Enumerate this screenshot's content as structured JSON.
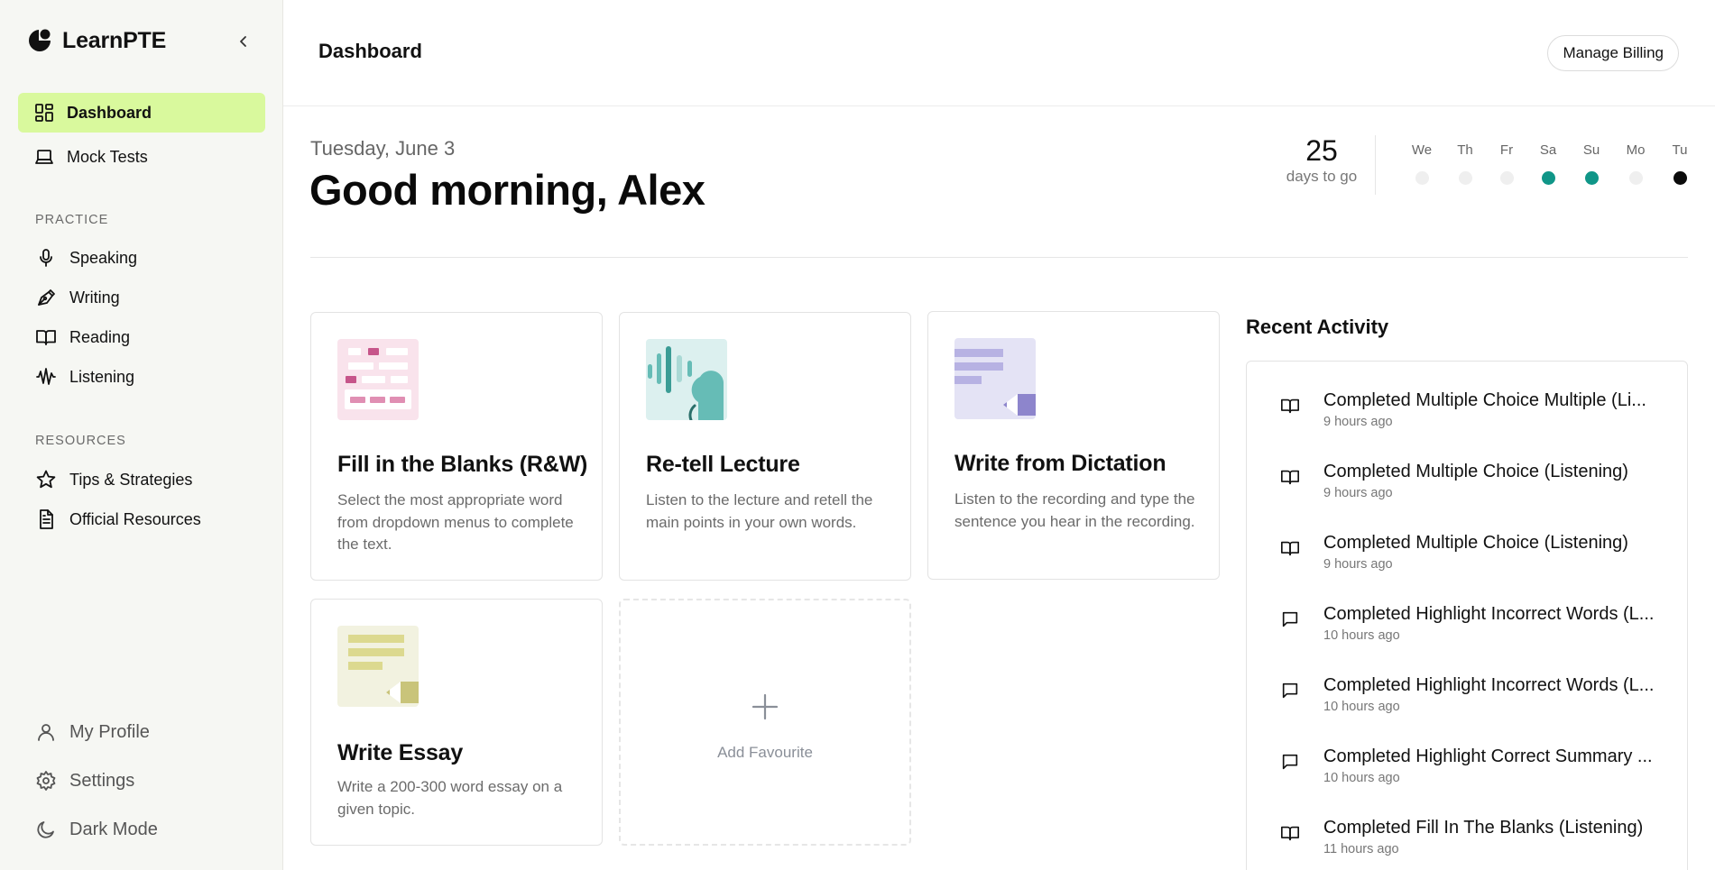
{
  "app": {
    "name": "LearnPTE"
  },
  "sidebar": {
    "main_items": [
      {
        "label": "Dashboard",
        "icon": "dashboard-icon",
        "active": true
      },
      {
        "label": "Mock Tests",
        "icon": "laptop-icon",
        "active": false
      }
    ],
    "practice": {
      "label": "PRACTICE",
      "items": [
        {
          "label": "Speaking",
          "icon": "microphone-icon"
        },
        {
          "label": "Writing",
          "icon": "pen-icon"
        },
        {
          "label": "Reading",
          "icon": "book-icon"
        },
        {
          "label": "Listening",
          "icon": "audio-wave-icon"
        }
      ]
    },
    "resources": {
      "label": "RESOURCES",
      "items": [
        {
          "label": "Tips & Strategies",
          "icon": "star-icon"
        },
        {
          "label": "Official Resources",
          "icon": "document-icon"
        }
      ]
    },
    "bottom_items": [
      {
        "label": "My Profile",
        "icon": "user-icon"
      },
      {
        "label": "Settings",
        "icon": "gear-icon"
      },
      {
        "label": "Dark Mode",
        "icon": "moon-icon"
      }
    ]
  },
  "header": {
    "title": "Dashboard",
    "billing_label": "Manage Billing"
  },
  "greeting": {
    "date": "Tuesday, June 3",
    "text": "Good morning, Alex",
    "countdown_value": "25",
    "countdown_label": "days to go"
  },
  "streak": [
    {
      "day": "We",
      "status": "none"
    },
    {
      "day": "Th",
      "status": "none"
    },
    {
      "day": "Fr",
      "status": "none"
    },
    {
      "day": "Sa",
      "status": "done"
    },
    {
      "day": "Su",
      "status": "done"
    },
    {
      "day": "Mo",
      "status": "none"
    },
    {
      "day": "Tu",
      "status": "today"
    }
  ],
  "favourites": [
    {
      "title": "Fill in the Blanks (R&W)",
      "description": "Select the most appropriate word from dropdown menus to complete the text.",
      "thumb_color": "#f9e3ec"
    },
    {
      "title": "Re-tell Lecture",
      "description": "Listen to the lecture and retell the main points in your own words.",
      "thumb_color": "#dcf0ef"
    },
    {
      "title": "Write from Dictation",
      "description": "Listen to the recording and type the sentence you hear in the recording.",
      "thumb_color": "#e4e3f5"
    },
    {
      "title": "Write Essay",
      "description": "Write a 200-300 word essay on a given topic.",
      "thumb_color": "#f2f2e0"
    }
  ],
  "add_favourite": {
    "label": "Add Favourite"
  },
  "recent_activity": {
    "title": "Recent Activity",
    "items": [
      {
        "prefix": "Completed",
        "name": "Multiple Choice Multiple (Li...",
        "time": "9 hours ago",
        "icon": "book-icon"
      },
      {
        "prefix": "Completed",
        "name": "Multiple Choice (Listening)",
        "time": "9 hours ago",
        "icon": "book-icon"
      },
      {
        "prefix": "Completed",
        "name": "Multiple Choice (Listening)",
        "time": "9 hours ago",
        "icon": "book-icon"
      },
      {
        "prefix": "Completed",
        "name": "Highlight Incorrect Words (L...",
        "time": "10 hours ago",
        "icon": "chat-icon"
      },
      {
        "prefix": "Completed",
        "name": "Highlight Incorrect Words (L...",
        "time": "10 hours ago",
        "icon": "chat-icon"
      },
      {
        "prefix": "Completed",
        "name": "Highlight Correct Summary ...",
        "time": "10 hours ago",
        "icon": "chat-icon"
      },
      {
        "prefix": "Completed",
        "name": "Fill In The Blanks (Listening)",
        "time": "11 hours ago",
        "icon": "book-icon"
      }
    ]
  }
}
